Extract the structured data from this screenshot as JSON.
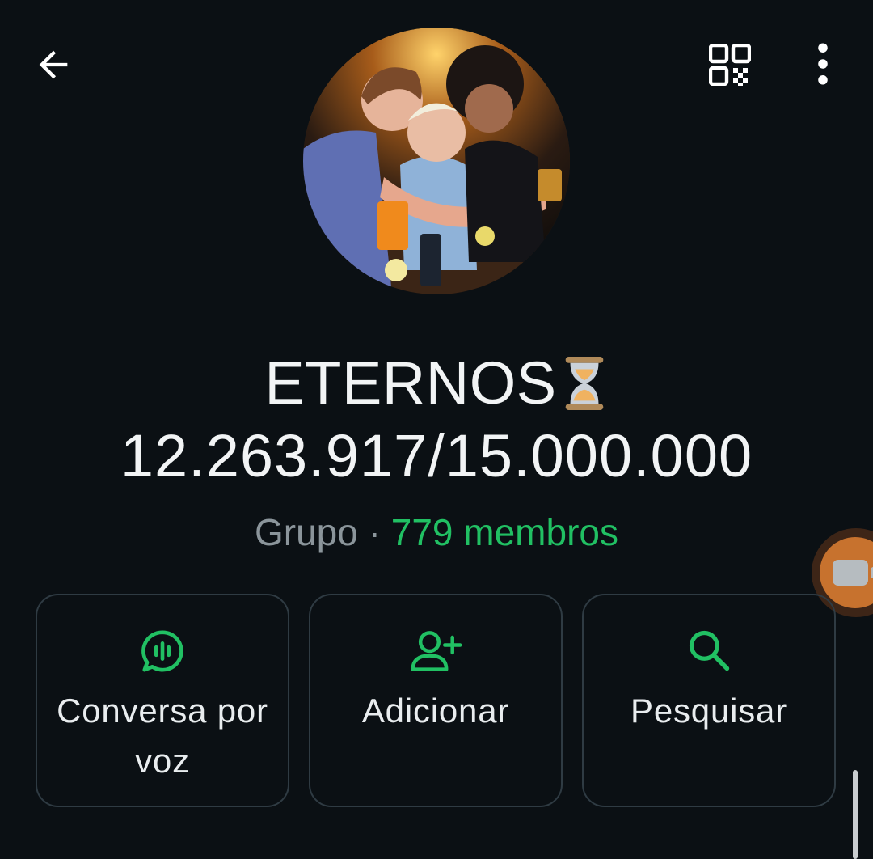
{
  "header": {
    "back_icon": "arrow-left-icon",
    "qr_icon": "qr-code-icon",
    "more_icon": "more-vertical-icon"
  },
  "group": {
    "name": "ETERNOS",
    "name_emoji": "hourglass-icon",
    "count_line": "12.263.917/15.000.000",
    "type_label": "Grupo",
    "separator": "·",
    "members_label": "779 membros"
  },
  "actions": [
    {
      "label": "Conversa por voz",
      "icon": "voice-chat-icon"
    },
    {
      "label": "Adicionar",
      "icon": "add-person-icon"
    },
    {
      "label": "Pesquisar",
      "icon": "search-icon"
    }
  ],
  "colors": {
    "background": "#0b1014",
    "accent": "#21c063",
    "muted": "#8b959b",
    "card_border": "#2f3b43",
    "floating_button": "#c7722e"
  },
  "floating_button_icon": "video-call-icon"
}
